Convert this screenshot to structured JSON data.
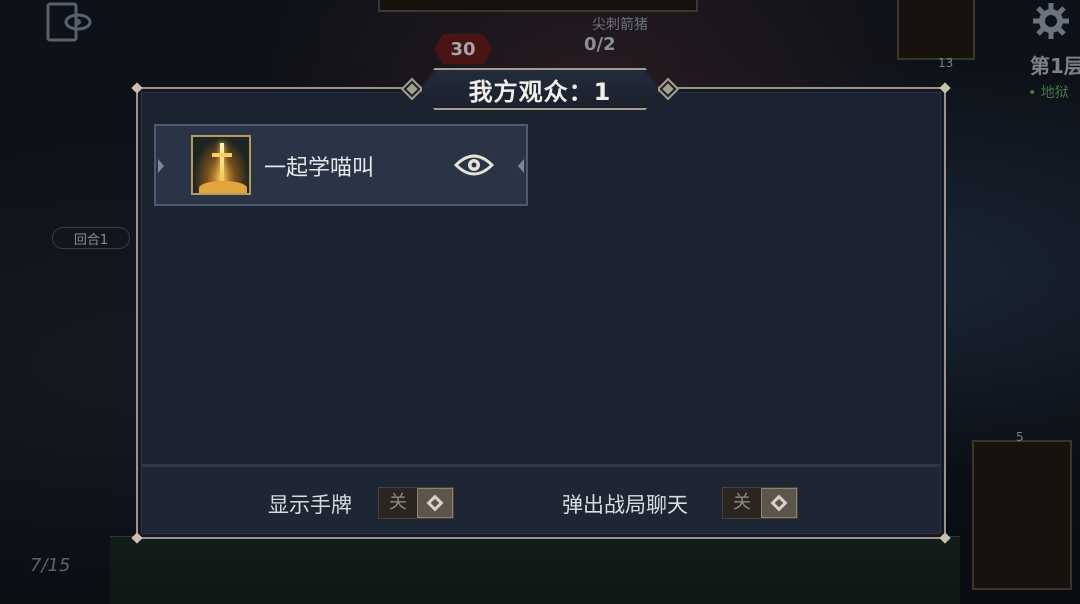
{
  "background": {
    "top_label": "尖刺箭猪",
    "hp": "30",
    "deck_count": "0/2",
    "round": "回合1",
    "hand_count": "7/15",
    "floor": "第1层",
    "floor_sub": "• 地狱",
    "pile_top": "13",
    "pile_bottom": "5"
  },
  "modal": {
    "title": "我方观众：1",
    "spectators": [
      {
        "name": "一起学喵叫",
        "avatar_icon": "golden-sword-icon",
        "action_icon": "eye-icon"
      }
    ]
  },
  "footer": {
    "show_hand_label": "显示手牌",
    "show_hand_toggle": "关",
    "chat_popup_label": "弹出战局聊天",
    "chat_popup_toggle": "关"
  },
  "colors": {
    "panel": "#1b2230",
    "panel_border": "#9b9484",
    "row": "#2b3446",
    "toggle_bg": "#2a2520"
  }
}
